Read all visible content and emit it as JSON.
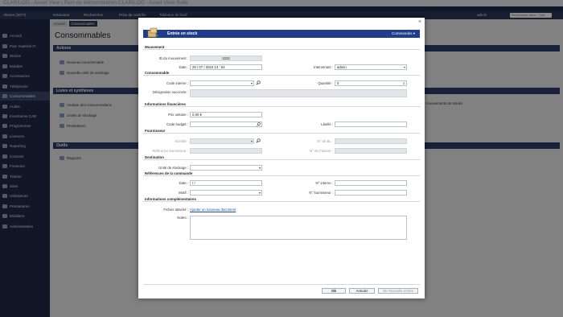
{
  "window": {
    "title": "CLARILOG - Asset View | Parc de démonstration CLARILOG - Asset View Suite"
  },
  "navbar": {
    "items": [
      "Alertes (3077)",
      "Extracteur",
      "Recherches",
      "Prise de contrôle",
      "Tableaux de bord"
    ],
    "user": "admin",
    "search_placeholder": "Rechercher dans : Tout (Alerte)"
  },
  "sidebar": {
    "items": [
      {
        "label": "Accueil",
        "icon": "home-icon"
      },
      {
        "label": "Parc matériel IT",
        "icon": "computer-icon"
      },
      {
        "label": "Stocks",
        "icon": "box-icon"
      },
      {
        "label": "Mobiles",
        "icon": "mobile-icon"
      },
      {
        "label": "Accessoires",
        "icon": "plug-icon"
      },
      {
        "label": "Téléphonie",
        "icon": "phone-icon"
      },
      {
        "label": "Consommables",
        "icon": "cart-icon",
        "active": true
      },
      {
        "label": "Audits",
        "icon": "audit-icon"
      },
      {
        "label": "Inventaires CAB",
        "icon": "barcode-icon"
      },
      {
        "label": "Programmes",
        "icon": "program-icon"
      },
      {
        "label": "Licences",
        "icon": "license-icon"
      },
      {
        "label": "Reporting",
        "icon": "report-icon"
      },
      {
        "label": "Contrats",
        "icon": "contract-icon"
      },
      {
        "label": "Finances",
        "icon": "finance-icon"
      },
      {
        "label": "Tickets",
        "icon": "ticket-icon"
      },
      {
        "label": "Sites",
        "icon": "site-icon"
      },
      {
        "label": "Utilisateurs",
        "icon": "users-icon"
      },
      {
        "label": "Prestataires",
        "icon": "provider-icon"
      },
      {
        "label": "Mobiliers",
        "icon": "furniture-icon"
      },
      {
        "label": "Administration",
        "icon": "admin-icon"
      }
    ]
  },
  "background": {
    "breadcrumb": [
      "Accueil",
      "Consommables"
    ],
    "page_title": "Consommables",
    "sections": [
      "Actions",
      "Listes et synthèses",
      "Outils"
    ],
    "actions": [
      "Nouveau consommable",
      "Nouvelle unité de stockage"
    ],
    "lists": [
      "Analyse des consommations",
      "Unités de stockage",
      "Prestataires"
    ],
    "lists_right": [
      "mouvements de stocks"
    ],
    "tools": [
      "Rapports"
    ]
  },
  "modal": {
    "title": "Entrée en stock",
    "menu_label": "Commandes",
    "close_label": "×",
    "sections": {
      "mouvement": "Mouvement",
      "consommable": "Consommable",
      "financieres": "Informations financières",
      "fournisseur": "Fournisseur",
      "destination": "Destination",
      "commande": "Références de la commande",
      "complementaires": "Informations complémentaires"
    },
    "fields": {
      "id_label": "ID du mouvement :",
      "id_value": "2222",
      "date_label": "Date :",
      "date_value": "29 / 07 / 2024   13 : 54",
      "intervenant_label": "Intervenant :",
      "intervenant_value": "admin",
      "code_interne_label": "Code interne :",
      "code_interne_value": "",
      "quantite_label": "Quantité :",
      "quantite_value": "0",
      "designation_label": "Désignation succincte :",
      "prix_label": "Prix unitaire :",
      "prix_value": "0,00 €",
      "code_budget_label": "Code budget :",
      "libelle_label": "Libellé :",
      "societe_label": "Société :",
      "no_bl_label": "N° de BL :",
      "ref_fournisseur_label": "Référence fournisseur :",
      "no_facture_label": "N° de Facture :",
      "unite_stockage_label": "Unité de stockage :",
      "date_cmd_label": "Date :",
      "date_cmd_value": "/     /",
      "no_interne_label": "N° interne :",
      "motif_label": "Motif :",
      "no_fournisseur_label": "N° fournisseur :",
      "fichier_label": "Fichier attaché :",
      "fichier_link": "Ajouter un nouveau document",
      "notes_label": "Notes :"
    },
    "buttons": {
      "ok": "Ok",
      "cancel": "Annuler",
      "ok_new": "Ok+Nouvelle entrée"
    }
  }
}
